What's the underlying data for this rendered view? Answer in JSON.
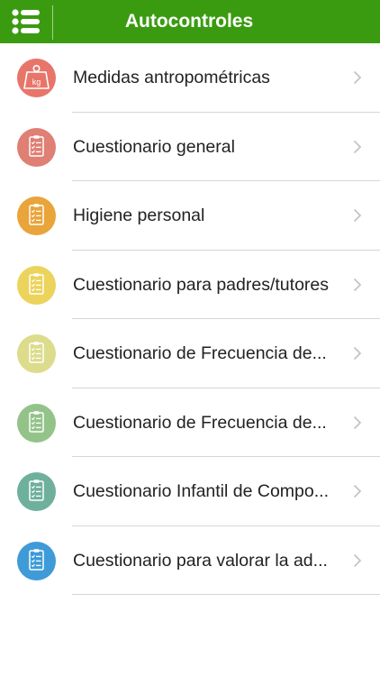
{
  "header": {
    "title": "Autocontroles",
    "menu_icon": "list-menu-icon",
    "background": "#3a9b10"
  },
  "items": [
    {
      "label": "Medidas antropométricas",
      "icon": "weight-kg-icon",
      "color": "#e8756a",
      "badge_text": "kg"
    },
    {
      "label": "Cuestionario general",
      "icon": "checklist-icon",
      "color": "#e07f74"
    },
    {
      "label": "Higiene personal",
      "icon": "checklist-icon",
      "color": "#e9a43a"
    },
    {
      "label": "Cuestionario para padres/tutores",
      "icon": "checklist-icon",
      "color": "#ecd35c"
    },
    {
      "label": "Cuestionario de Frecuencia de...",
      "icon": "checklist-icon",
      "color": "#dcdc8c"
    },
    {
      "label": "Cuestionario de Frecuencia de...",
      "icon": "checklist-icon",
      "color": "#94c38a"
    },
    {
      "label": "Cuestionario Infantil de Compo...",
      "icon": "checklist-icon",
      "color": "#6fb09c"
    },
    {
      "label": "Cuestionario para valorar la ad...",
      "icon": "checklist-icon",
      "color": "#3f9bd8"
    }
  ]
}
